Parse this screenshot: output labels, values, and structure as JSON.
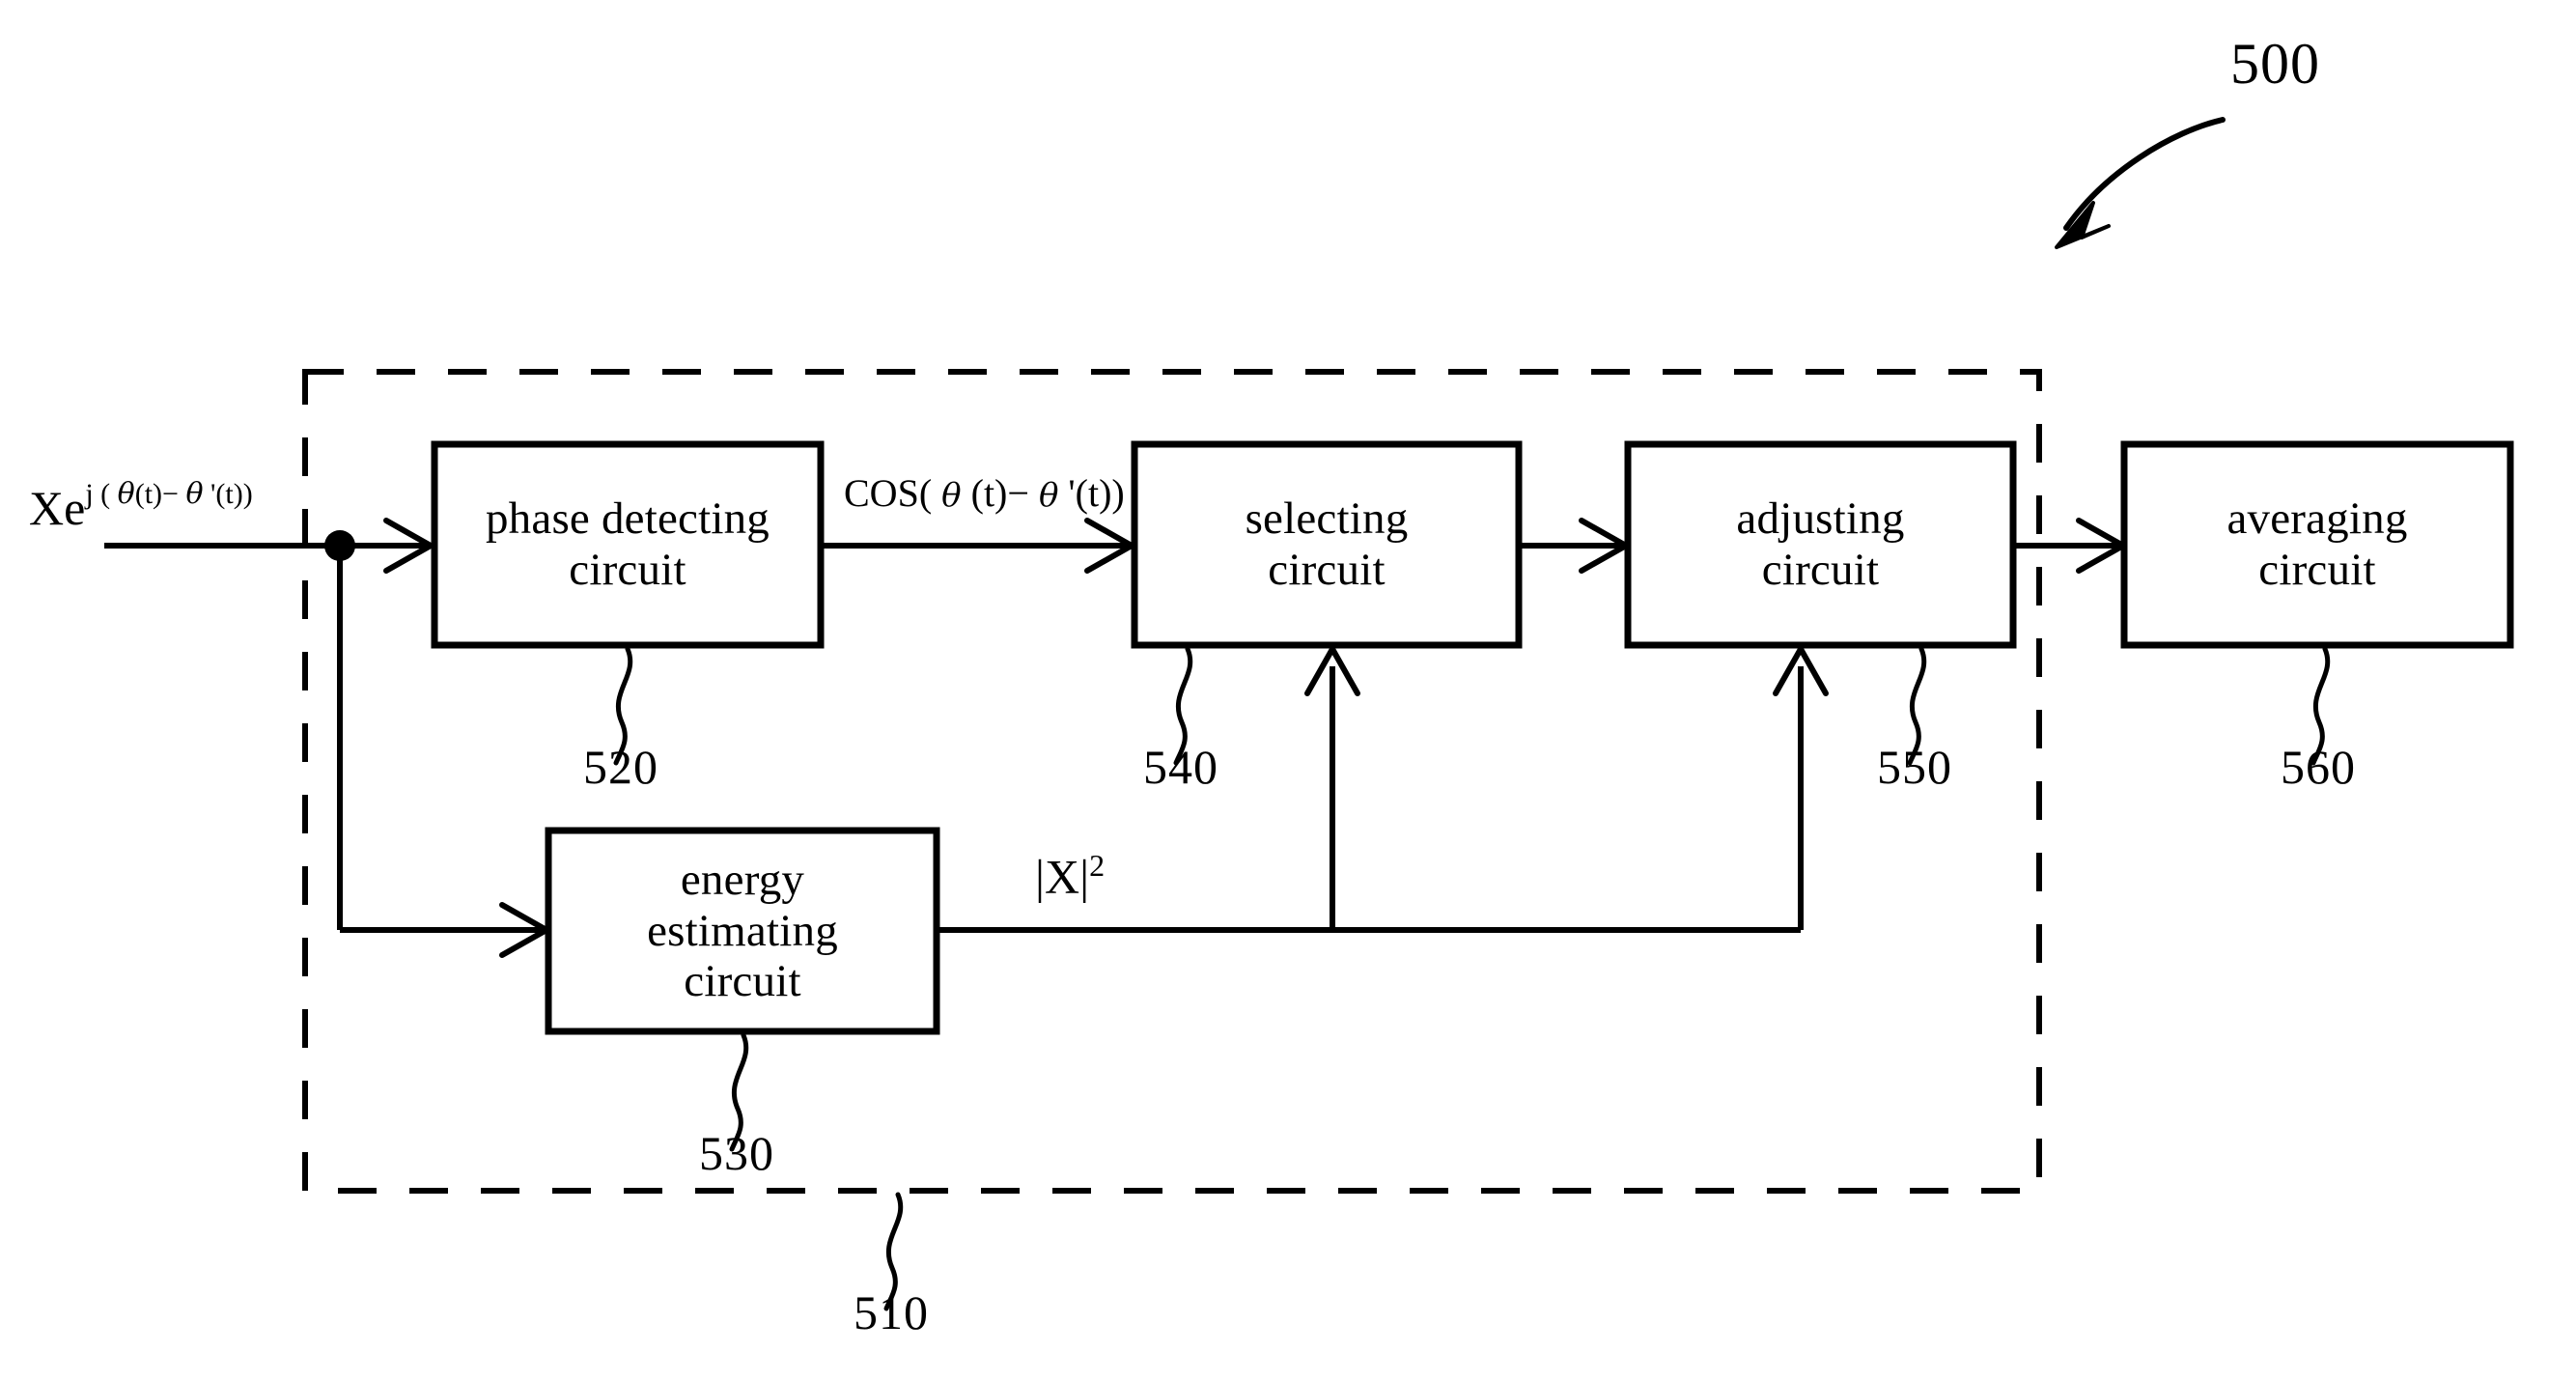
{
  "figure": {
    "overall_ref": "500",
    "dashed_group_ref": "510",
    "input_signal": {
      "base": "Xe",
      "exponent_prefix": "j ( ",
      "theta1": "θ",
      "t1": "(t)− ",
      "theta2": "θ",
      "t2": " '(t))"
    },
    "cos_signal": {
      "prefix": "COS( ",
      "theta1": "θ",
      "t1": " (t)− ",
      "theta2": "θ",
      "t2": " '(t))"
    },
    "energy_signal": {
      "base": "|X|",
      "exponent": "2"
    },
    "blocks": [
      {
        "id": "phase-detecting-circuit",
        "line1": "phase detecting",
        "line2": "circuit",
        "ref": "520"
      },
      {
        "id": "energy-estimating-circuit",
        "line1": "energy",
        "line2": "estimating",
        "line3": "circuit",
        "ref": "530"
      },
      {
        "id": "selecting-circuit",
        "line1": "selecting",
        "line2": "circuit",
        "ref": "540"
      },
      {
        "id": "adjusting-circuit",
        "line1": "adjusting",
        "line2": "circuit",
        "ref": "550"
      },
      {
        "id": "averaging-circuit",
        "line1": "averaging",
        "line2": "circuit",
        "ref": "560"
      }
    ],
    "colors": {
      "ink": "#000000",
      "background": "#ffffff"
    }
  }
}
